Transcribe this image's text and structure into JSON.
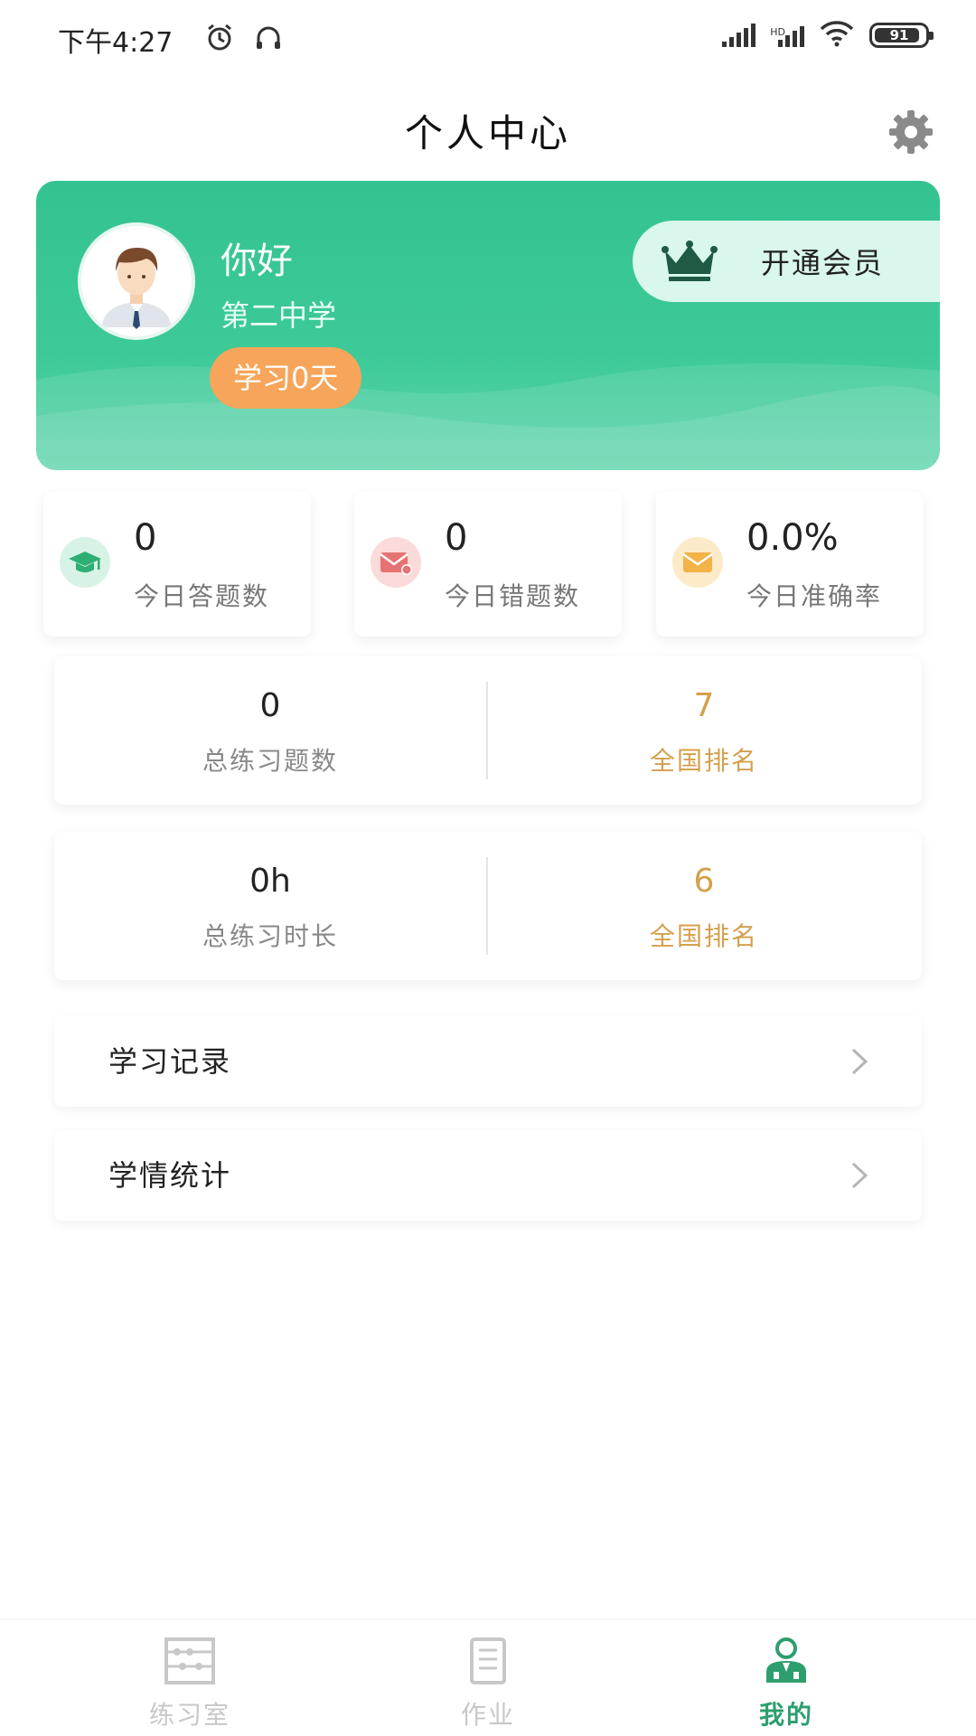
{
  "status_bar": {
    "time": "下午4:27",
    "hd_label": "HD",
    "battery_level": "91",
    "icons": [
      "alarm-icon",
      "headphones-icon",
      "signal-icon",
      "hd-signal-icon",
      "wifi-icon",
      "battery-icon"
    ]
  },
  "header": {
    "title": "个人中心",
    "settings_icon": "gear-icon"
  },
  "profile": {
    "greeting": "你好",
    "school": "第二中学",
    "study_days": "学习0天",
    "vip_label": "开通会员",
    "vip_icon": "crown-icon"
  },
  "today_stats": [
    {
      "value": "0",
      "label": "今日答题数",
      "icon": "graduation-cap-icon",
      "icon_bg": "#d7f3e6",
      "icon_color": "#2fae74"
    },
    {
      "value": "0",
      "label": "今日错题数",
      "icon": "error-mail-icon",
      "icon_bg": "#fbdada",
      "icon_color": "#e57373"
    },
    {
      "value": "0.0%",
      "label": "今日准确率",
      "icon": "mail-icon",
      "icon_bg": "#fdeac8",
      "icon_color": "#f3b347"
    }
  ],
  "totals": [
    {
      "left": {
        "value": "0",
        "label": "总练习题数"
      },
      "right": {
        "value": "7",
        "label": "全国排名"
      }
    },
    {
      "left": {
        "value": "0h",
        "label": "总练习时长"
      },
      "right": {
        "value": "6",
        "label": "全国排名"
      }
    }
  ],
  "menu": [
    {
      "label": "学习记录"
    },
    {
      "label": "学情统计"
    }
  ],
  "tabs": [
    {
      "label": "练习室",
      "icon": "abacus-icon",
      "active": false
    },
    {
      "label": "作业",
      "icon": "document-icon",
      "active": false
    },
    {
      "label": "我的",
      "icon": "user-icon",
      "active": true
    }
  ],
  "colors": {
    "brand_green": "#3cc896",
    "accent_orange": "#f6a55a",
    "rank_gold": "#d4a04c",
    "tab_active": "#2e9e6e"
  }
}
